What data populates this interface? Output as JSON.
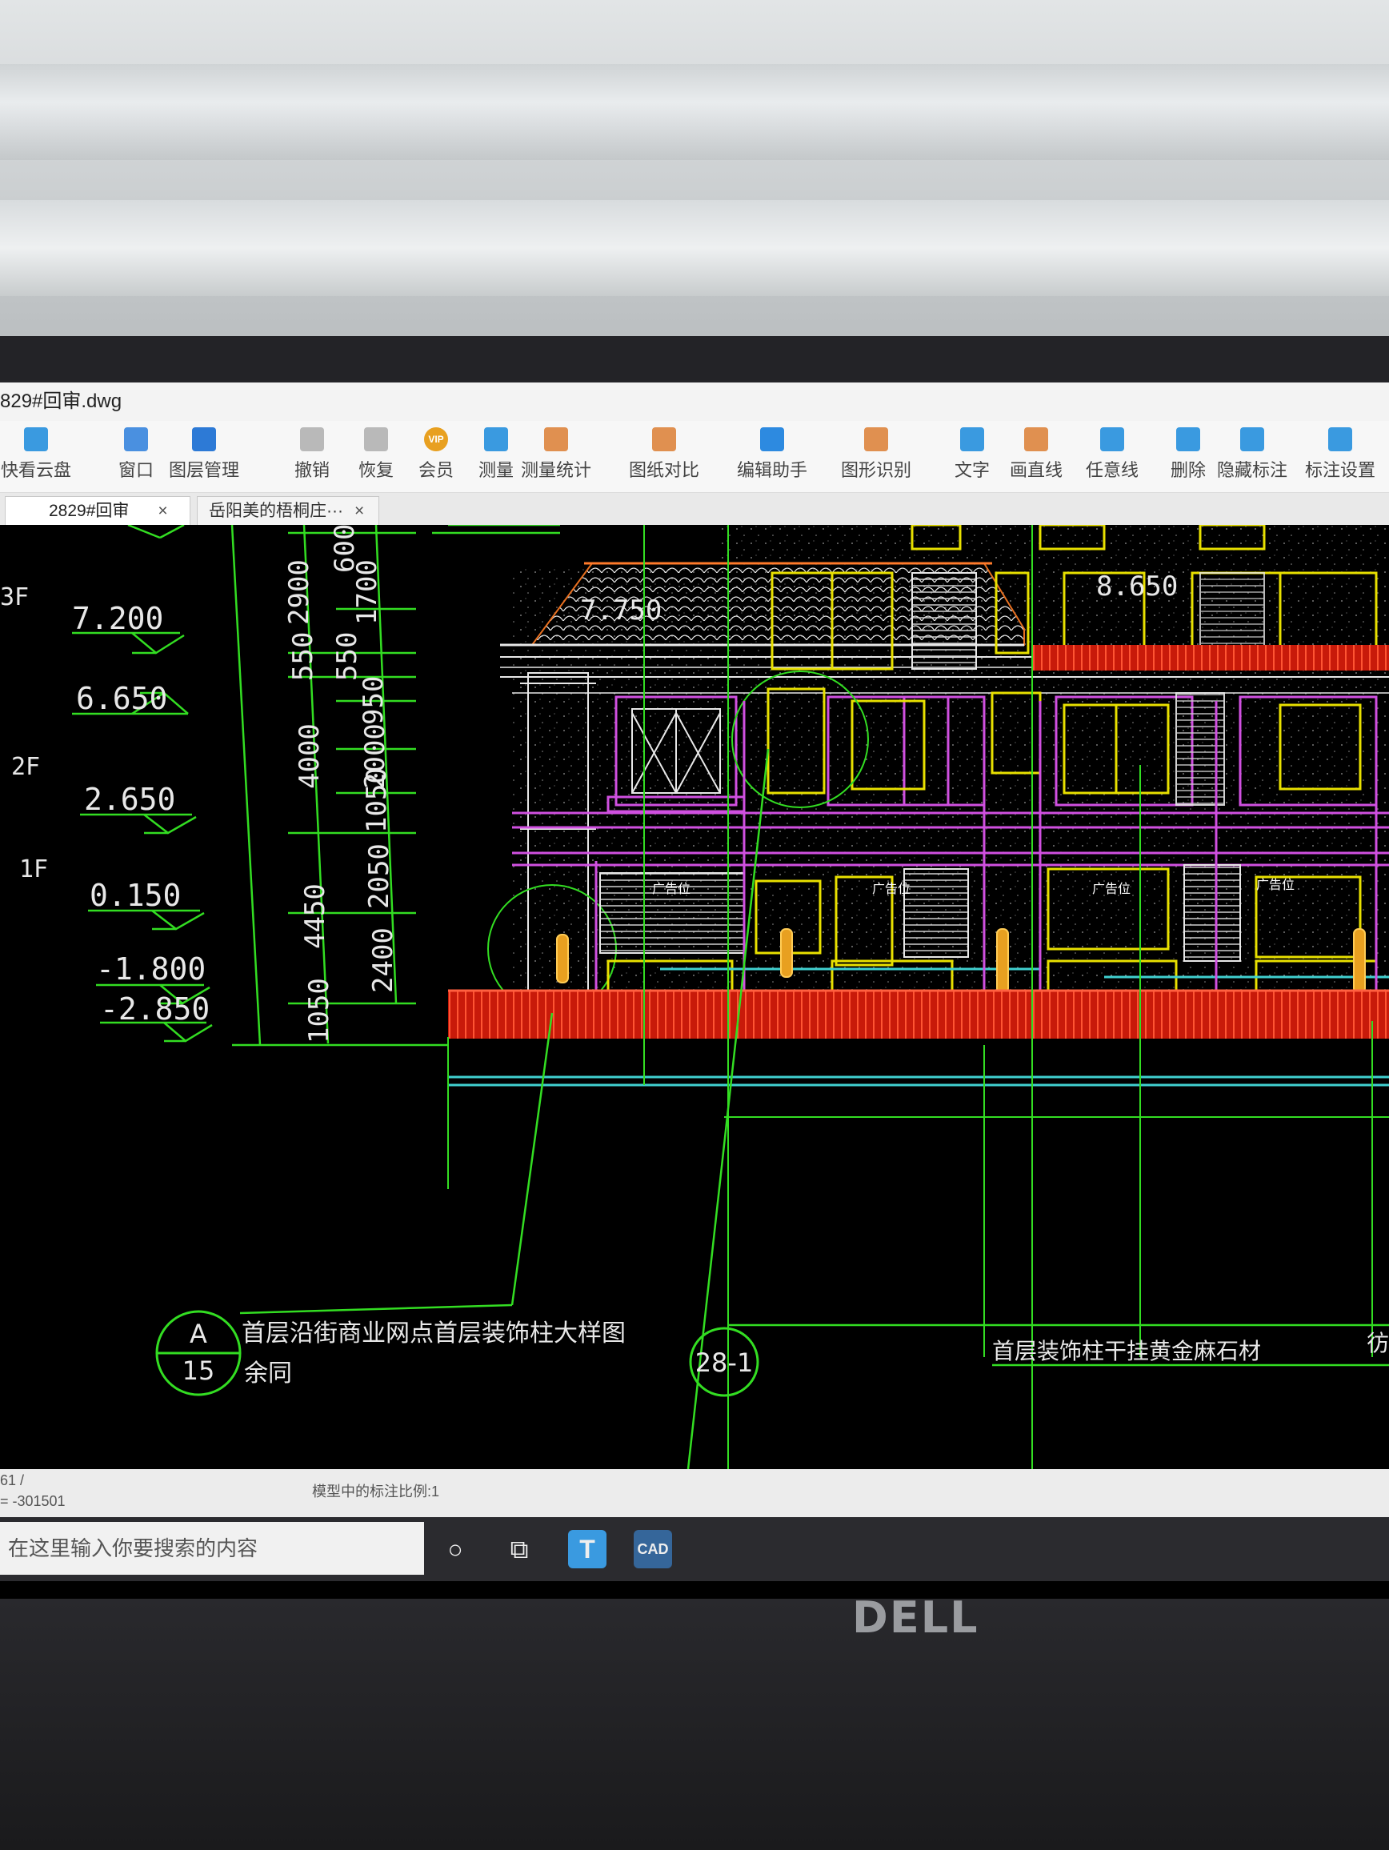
{
  "window": {
    "title": "829#回审.dwg"
  },
  "toolbar": {
    "items": [
      {
        "label": "快看云盘",
        "icon": "cloud-icon"
      },
      {
        "label": "窗口",
        "icon": "window-icon"
      },
      {
        "label": "图层管理",
        "icon": "layers-icon"
      },
      {
        "label": "撤销",
        "icon": "undo-icon"
      },
      {
        "label": "恢复",
        "icon": "redo-icon"
      },
      {
        "label": "会员",
        "icon": "vip-icon"
      },
      {
        "label": "测量",
        "icon": "measure-icon"
      },
      {
        "label": "测量统计",
        "icon": "measure-stats-icon"
      },
      {
        "label": "图纸对比",
        "icon": "compare-icon"
      },
      {
        "label": "编辑助手",
        "icon": "edit-assistant-icon"
      },
      {
        "label": "图形识别",
        "icon": "shape-recognition-icon"
      },
      {
        "label": "文字",
        "icon": "text-icon"
      },
      {
        "label": "画直线",
        "icon": "line-icon"
      },
      {
        "label": "任意线",
        "icon": "freehand-icon"
      },
      {
        "label": "删除",
        "icon": "eraser-icon"
      },
      {
        "label": "隐藏标注",
        "icon": "hide-annotation-icon"
      },
      {
        "label": "标注设置",
        "icon": "annotation-settings-icon"
      }
    ],
    "vip_badge": "VIP"
  },
  "tabs": [
    {
      "label": "2829#回审",
      "close": "×",
      "active": true
    },
    {
      "label": "岳阳美的梧桐庄···",
      "close": "×",
      "active": false
    }
  ],
  "drawing": {
    "floors": [
      "3F",
      "2F",
      "1F"
    ],
    "elevations": [
      "7.200",
      "6.650",
      "2.650",
      "0.150",
      "-1.800",
      "-2.850"
    ],
    "dims_outer": [
      "2900",
      "550",
      "4000",
      "4450",
      "1050"
    ],
    "dims_inner": [
      "600",
      "1700",
      "550",
      "950",
      "2000",
      "1050",
      "2050",
      "2400"
    ],
    "dim_top_partial": "600",
    "building_elevations": [
      "7.750",
      "8.650"
    ],
    "signage": [
      "广告位",
      "广告位",
      "广告位",
      "广告位"
    ],
    "callout_a": {
      "letter": "A",
      "sheet": "15"
    },
    "callout_28": "28-1",
    "note_main": "首层沿街商业网点首层装饰柱大样图",
    "note_sub": "余同",
    "note_right": "首层装饰柱干挂黄金麻石材",
    "note_edge": "彷"
  },
  "statusbar": {
    "line1": "61 /",
    "line2": "= -301501",
    "scale": "模型中的标注比例:1"
  },
  "taskbar": {
    "search_placeholder": "在这里输入你要搜索的内容",
    "cad_label": "CAD"
  },
  "brand": "DELL",
  "colors": {
    "cad_bg": "#000000",
    "cad_green": "#33dd22",
    "cad_yellow": "#e8e000",
    "cad_magenta": "#d050e0",
    "cad_red": "#ee2211",
    "cad_white": "#e8e8e8",
    "cad_cyan": "#40d0d0"
  }
}
